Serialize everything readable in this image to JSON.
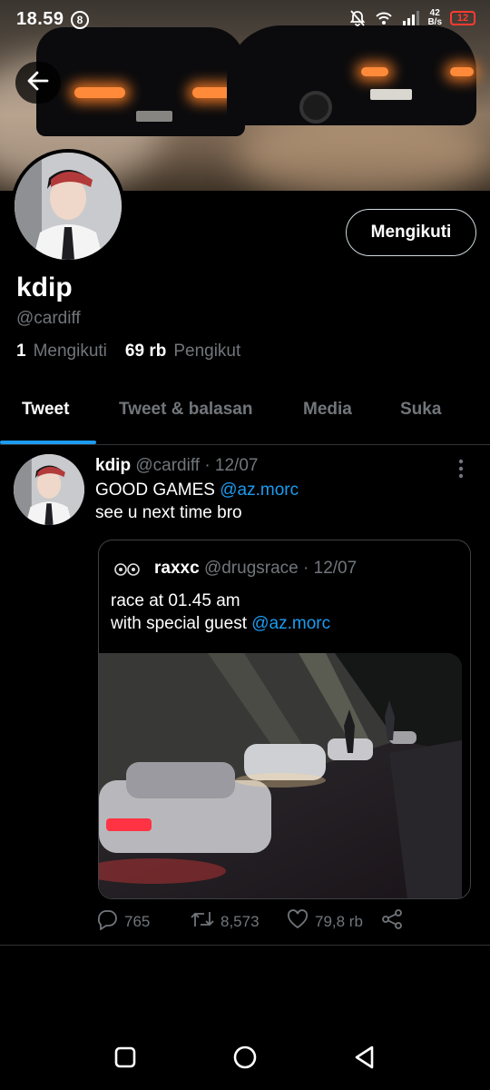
{
  "status_bar": {
    "time": "18.59",
    "sim_icon": "8",
    "speed_top": "42",
    "speed_bottom": "B/s",
    "battery": "12",
    "icons": [
      "mute-bell-icon",
      "wifi-icon",
      "signal-icon",
      "battery-icon"
    ]
  },
  "profile": {
    "name": "kdip",
    "handle": "@cardiff",
    "following_count": "1",
    "following_label": "Mengikuti",
    "followers_count": "69 rb",
    "followers_label": "Pengikut",
    "follow_button": "Mengikuti"
  },
  "tabs": [
    {
      "label": "Tweet",
      "active": true
    },
    {
      "label": "Tweet & balasan",
      "active": false
    },
    {
      "label": "Media",
      "active": false
    },
    {
      "label": "Suka",
      "active": false
    }
  ],
  "tweet": {
    "name": "kdip",
    "handle": "@cardiff",
    "date": "· 12/07",
    "line1_text": "GOOD GAMES ",
    "line1_mention": "@az.morc",
    "line2": "see u next time bro",
    "quote": {
      "name": "raxxc",
      "handle": "@drugsrace",
      "date": "· 12/07",
      "line1": "race at 01.45 am",
      "line2_text": "with special guest ",
      "line2_mention": "@az.morc"
    },
    "actions": {
      "replies": "765",
      "retweets": "8,573",
      "likes": "79,8 rb"
    }
  },
  "colors": {
    "accent": "#1d9bf0",
    "background": "#000000",
    "muted": "#71767b",
    "battery_low": "#ff3b30"
  }
}
